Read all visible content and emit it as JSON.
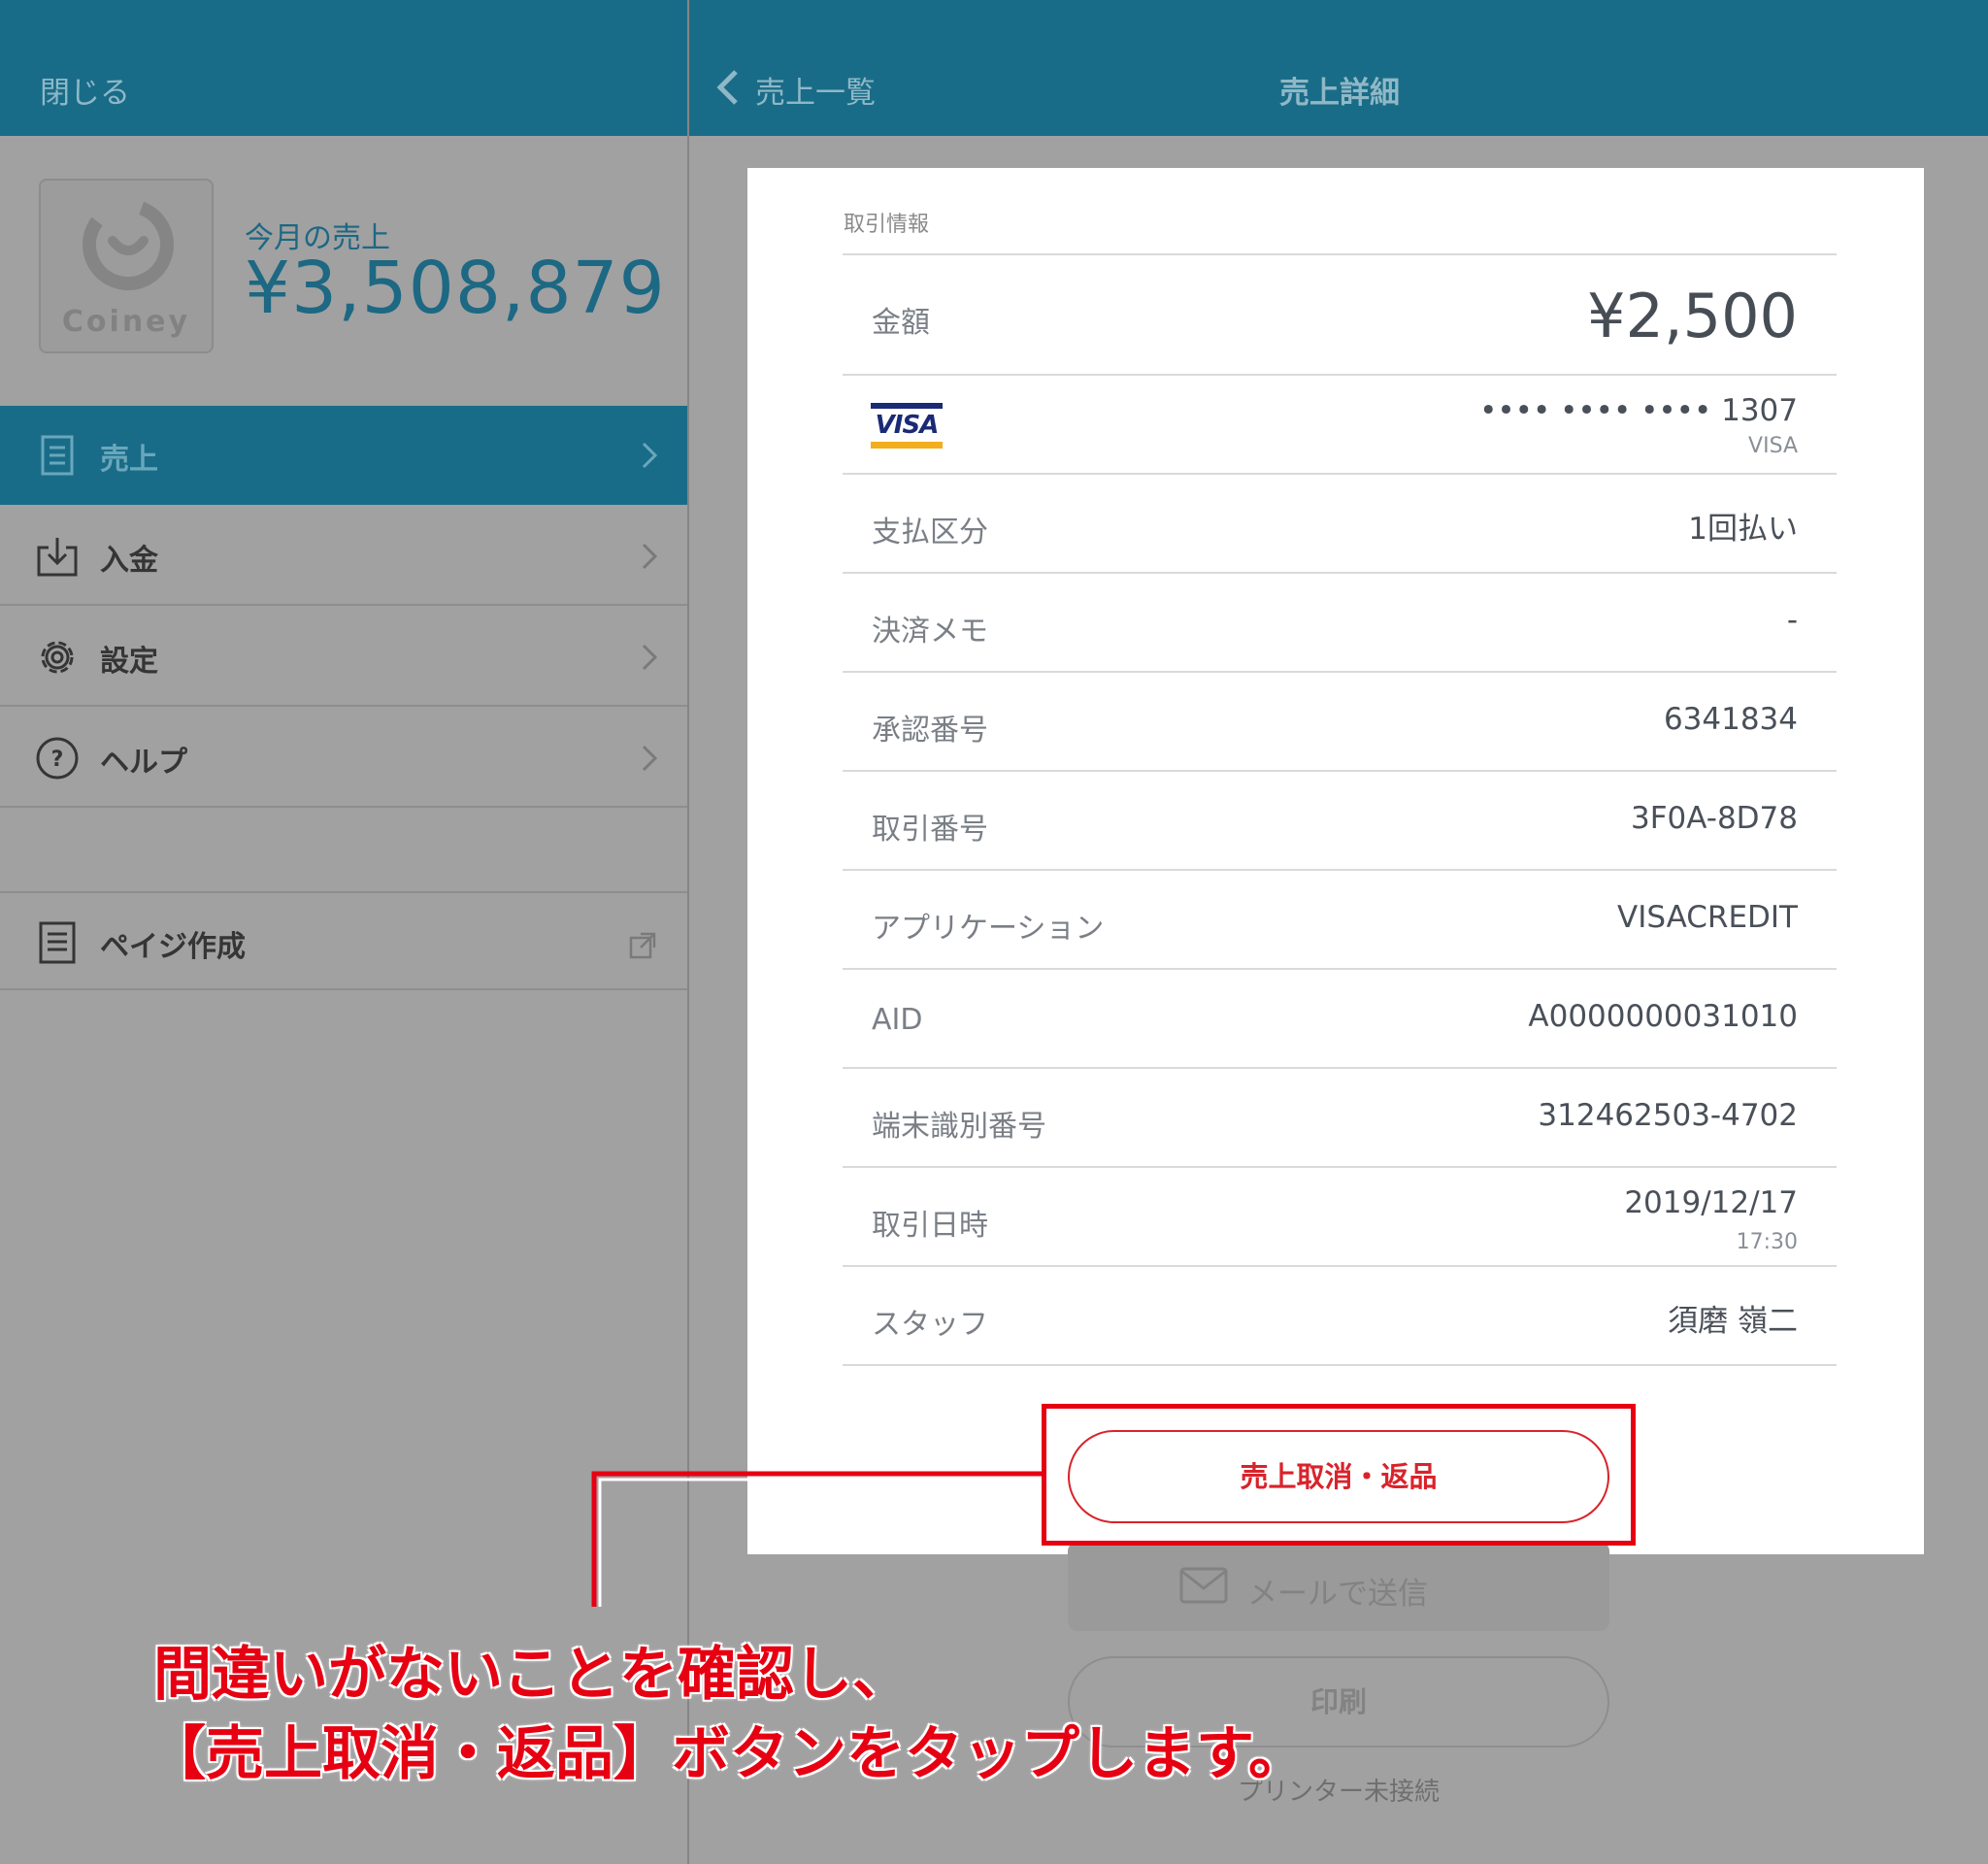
{
  "colors": {
    "header_teal": "#196c87",
    "accent_red": "#e60012",
    "overlay_gray": "#a1a1a1"
  },
  "sidebar": {
    "close_label": "閉じる",
    "logo_text": "Coiney",
    "sales_label": "今月の売上",
    "sales_amount": "¥3,508,879",
    "items": [
      {
        "label": "売上",
        "icon": "document-icon",
        "active": true
      },
      {
        "label": "入金",
        "icon": "deposit-icon",
        "active": false
      },
      {
        "label": "設定",
        "icon": "gear-icon",
        "active": false
      },
      {
        "label": "ヘルプ",
        "icon": "help-icon",
        "active": false
      },
      {
        "label": "ペイジ作成",
        "icon": "page-icon",
        "active": false
      }
    ]
  },
  "header": {
    "back_label": "売上一覧",
    "title": "売上詳細"
  },
  "detail": {
    "section_title": "取引情報",
    "amount_label": "金額",
    "amount_value": "¥2,500",
    "card_number": "•••• •••• •••• 1307",
    "card_brand": "VISA",
    "rows": [
      {
        "label": "支払区分",
        "value": "1回払い"
      },
      {
        "label": "決済メモ",
        "value": "-"
      },
      {
        "label": "承認番号",
        "value": "6341834"
      },
      {
        "label": "取引番号",
        "value": "3F0A-8D78"
      },
      {
        "label": "アプリケーション",
        "value": "VISACREDIT"
      },
      {
        "label": "AID",
        "value": "A0000000031010"
      },
      {
        "label": "端末識別番号",
        "value": "312462503-4702"
      },
      {
        "label": "取引日時",
        "value": "2019/12/17",
        "sub": "17:30"
      },
      {
        "label": "スタッフ",
        "value": "須磨 嶺二"
      }
    ]
  },
  "actions": {
    "refund_label": "売上取消・返品",
    "email_label": "メールで送信",
    "print_label": "印刷",
    "printer_status": "プリンター未接続"
  },
  "annotation": {
    "line1": "間違いがないことを確認し、",
    "line2": "【売上取消・返品】ボタンをタップします。"
  }
}
